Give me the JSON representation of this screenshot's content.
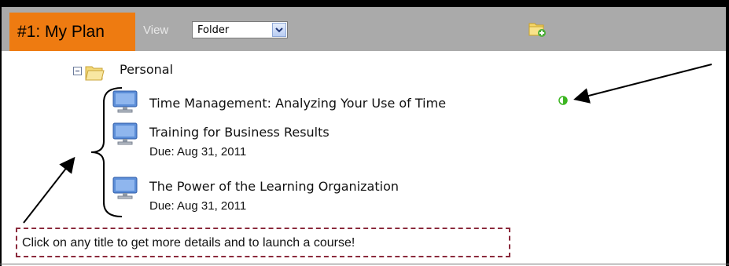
{
  "header": {
    "plan_label": "#1: My Plan",
    "view_label": "View",
    "view_select": {
      "value": "Folder"
    },
    "new_folder_icon": "folder-add-icon"
  },
  "tree": {
    "folder": {
      "label": "Personal",
      "expanded": true
    },
    "courses": [
      {
        "title": "Time Management: Analyzing Your Use of Time",
        "due": "",
        "status": "in-progress"
      },
      {
        "title": "Training for Business Results",
        "due": "Due: Aug 31, 2011"
      },
      {
        "title": "The Power of the Learning Organization",
        "due": "Due: Aug 31, 2011"
      }
    ]
  },
  "callout": {
    "text": "Click on any title to get more details and to launch a course!"
  },
  "colors": {
    "toolbar": "#aaaaaa",
    "badge": "#ee7b11",
    "status_green": "#3cb521",
    "callout_border": "#8b2a3c"
  }
}
